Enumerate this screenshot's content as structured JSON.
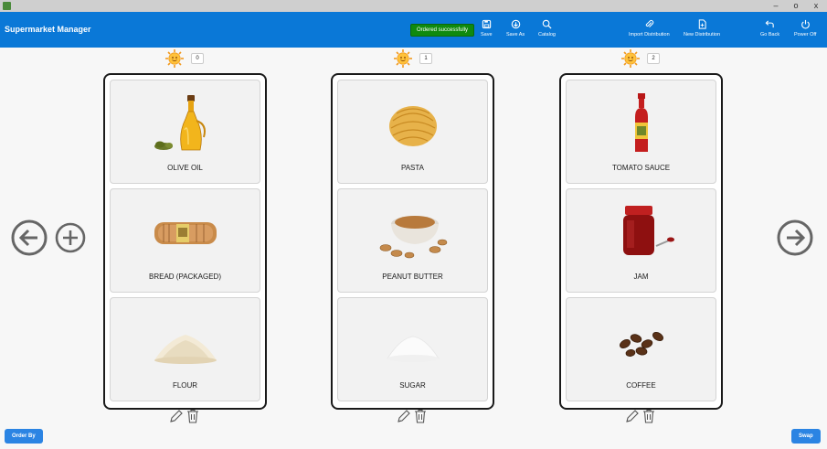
{
  "header": {
    "title": "Supermarket Manager",
    "toast": "Ordered successfully",
    "buttons": {
      "save": "Save",
      "save_as": "Save As",
      "catalog": "Catalog",
      "import": "Import Distribution",
      "new": "New Distribution",
      "go_back": "Go Back",
      "power_off": "Power Off"
    }
  },
  "window": {
    "minimize": "–",
    "maximize": "o",
    "close": "x"
  },
  "columns": [
    {
      "index": "0",
      "items": [
        "OLIVE OIL",
        "BREAD (PACKAGED)",
        "FLOUR"
      ]
    },
    {
      "index": "1",
      "items": [
        "PASTA",
        "PEANUT BUTTER",
        "SUGAR"
      ]
    },
    {
      "index": "2",
      "items": [
        "TOMATO SAUCE",
        "JAM",
        "COFFEE"
      ]
    }
  ],
  "footer": {
    "order_by": "Order By",
    "swap": "Swap"
  },
  "colors": {
    "accent": "#0a78d7",
    "toast": "#0f8a0f"
  }
}
